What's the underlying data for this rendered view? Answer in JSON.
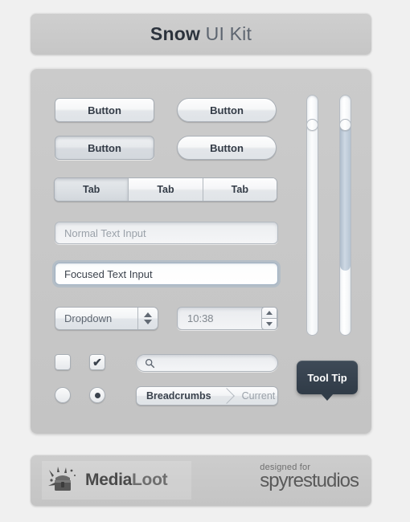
{
  "header": {
    "title_bold": "Snow",
    "title_rest": " UI Kit"
  },
  "buttons": [
    {
      "label": "Button",
      "shape": "rect",
      "state": "normal"
    },
    {
      "label": "Button",
      "shape": "pill",
      "state": "normal"
    },
    {
      "label": "Button",
      "shape": "rect",
      "state": "pressed"
    },
    {
      "label": "Button",
      "shape": "pill",
      "state": "normal"
    }
  ],
  "tabs": {
    "items": [
      {
        "label": "Tab",
        "active": true
      },
      {
        "label": "Tab",
        "active": false
      },
      {
        "label": "Tab",
        "active": false
      }
    ]
  },
  "inputs": {
    "normal": {
      "value": "Normal Text Input",
      "placeholder": "Normal Text Input"
    },
    "focused": {
      "value": "Focused Text Input",
      "placeholder": "Focused Text Input"
    }
  },
  "dropdown": {
    "label": "Dropdown"
  },
  "time_field": {
    "value": "10:38"
  },
  "checkbox": {
    "unchecked_label": "",
    "checked_glyph": "✔"
  },
  "radio": {
    "unselected_label": "",
    "selected_label": ""
  },
  "search": {
    "value": "",
    "placeholder": "",
    "icon": "search-icon"
  },
  "breadcrumbs": {
    "items": [
      {
        "label": "Breadcrumbs",
        "current": false
      },
      {
        "label": "Current",
        "current": true
      }
    ]
  },
  "tooltip": {
    "label": "Tool Tip"
  },
  "sliders": [
    {
      "name": "slider-left",
      "fill": "plain",
      "value_percent": 88
    },
    {
      "name": "slider-right",
      "fill": "blue",
      "value_percent": 88
    }
  ],
  "footer": {
    "medialoot": {
      "bold": "Media",
      "light": "Loot"
    },
    "spyre": {
      "top": "designed for",
      "main": "spyrestudios"
    }
  },
  "colors": {
    "page_bg": "#f0f0f0",
    "panel_bg": "#c8c8c8",
    "text_dark": "#2b323c",
    "text_muted": "#9aa1a9",
    "tooltip_bg": "#343f4b",
    "slider_fill_blue": "#b9c6d4"
  }
}
